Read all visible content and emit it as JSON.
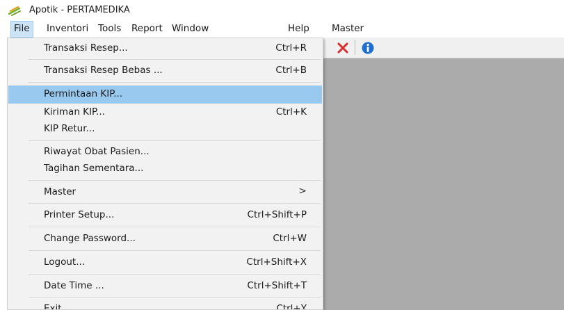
{
  "window": {
    "title": "Apotik - PERTAMEDIKA"
  },
  "menubar": {
    "items": [
      {
        "label": "File",
        "active": true
      },
      {
        "label": "Inventori"
      },
      {
        "label": "Tools"
      },
      {
        "label": "Report"
      },
      {
        "label": "Window"
      },
      {
        "label": "Help"
      },
      {
        "label": "Master"
      }
    ]
  },
  "toolbar": {
    "buttons": [
      {
        "icon": "close-x-icon",
        "color": "#d92b2b"
      },
      {
        "icon": "info-icon",
        "color": "#1e6fd0"
      }
    ]
  },
  "file_menu": {
    "items": [
      {
        "label": "Transaksi Resep...",
        "shortcut": "Ctrl+R"
      },
      {
        "label": "Transaksi Resep Bebas ...",
        "shortcut": "Ctrl+B"
      },
      {
        "label": "Permintaan KIP...",
        "shortcut": "",
        "highlighted": true
      },
      {
        "label": "Kiriman KIP...",
        "shortcut": "Ctrl+K"
      },
      {
        "label": "KIP Retur...",
        "shortcut": ""
      },
      {
        "label": "Riwayat Obat Pasien...",
        "shortcut": ""
      },
      {
        "label": "Tagihan Sementara...",
        "shortcut": ""
      },
      {
        "label": "Master",
        "shortcut": "",
        "submenu_arrow": ">"
      },
      {
        "label": "Printer Setup...",
        "shortcut": "Ctrl+Shift+P"
      },
      {
        "label": "Change Password...",
        "shortcut": "Ctrl+W"
      },
      {
        "label": "Logout...",
        "shortcut": "Ctrl+Shift+X"
      },
      {
        "label": "Date Time ...",
        "shortcut": "Ctrl+Shift+T"
      },
      {
        "label": "Exit",
        "shortcut": "Ctrl+Y"
      }
    ]
  },
  "colors": {
    "menu_highlight": "#99c9ef",
    "client_background": "#ababab",
    "menu_background": "#f2f2f2"
  }
}
